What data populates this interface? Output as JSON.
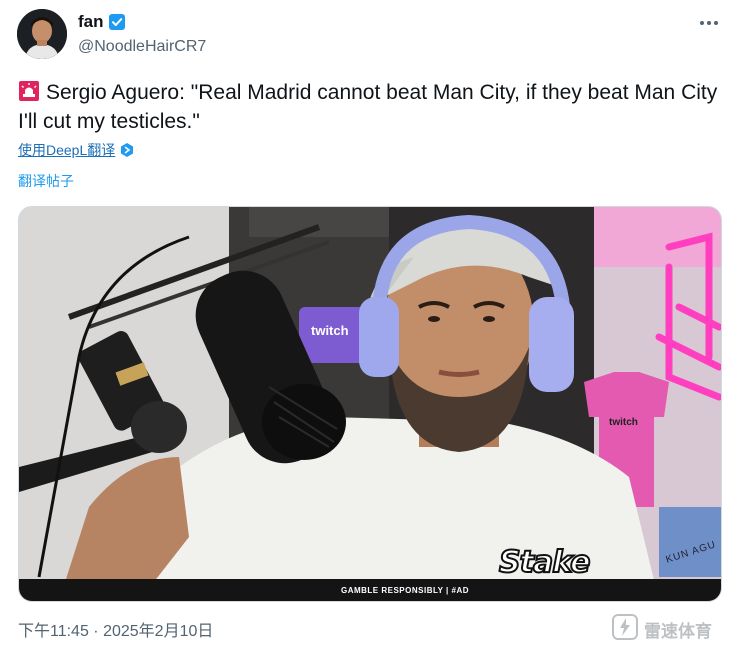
{
  "author": {
    "display_name": "fan",
    "handle": "@NoodleHairCR7",
    "verified": true,
    "avatar_icon": "profile-avatar"
  },
  "tweet": {
    "text": "Sergio Aguero: \"Real Madrid cannot beat Man City, if they beat Man City I'll cut my testicles.\"",
    "emoji_icon": "police-siren-icon",
    "translate_deepl_label": "使用DeepL翻译",
    "translate_post_label": "翻译帖子"
  },
  "media": {
    "ad_bar_text": "GAMBLE RESPONSIBLY  |  #AD",
    "stake_logo": "Stake",
    "shirt_text": "twitch",
    "sign_text": "twitch",
    "kun_text": "KUN AGU"
  },
  "footer": {
    "timestamp": "下午11:45 · 2025年2月10日",
    "watermark_text": "雷速体育"
  },
  "colors": {
    "verified_blue": "#1d9bf0",
    "link_blue": "#1d6fb8",
    "text_secondary": "#536471",
    "neon_pink": "#ff2fb0"
  }
}
